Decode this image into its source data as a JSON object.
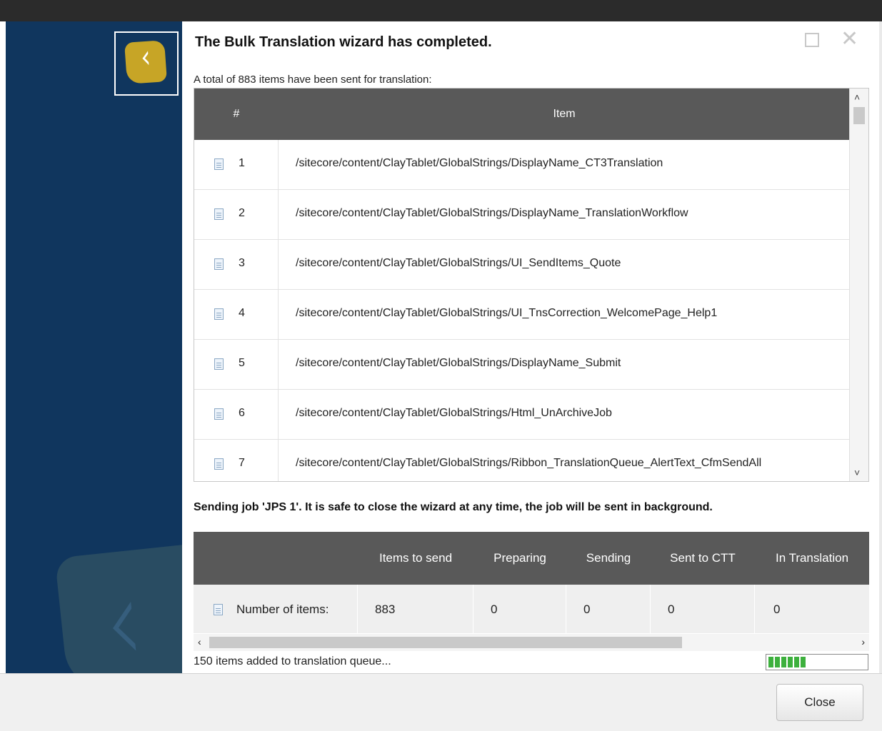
{
  "dialog": {
    "title": "The Bulk Translation wizard has completed.",
    "subtitle": "A total of 883 items have been sent for translation:",
    "maximize_icon": "maximize-icon",
    "close_icon": "close-icon"
  },
  "items_table": {
    "columns": [
      "#",
      "Item"
    ],
    "rows": [
      {
        "num": "1",
        "path": "/sitecore/content/ClayTablet/GlobalStrings/DisplayName_CT3Translation"
      },
      {
        "num": "2",
        "path": "/sitecore/content/ClayTablet/GlobalStrings/DisplayName_TranslationWorkflow"
      },
      {
        "num": "3",
        "path": "/sitecore/content/ClayTablet/GlobalStrings/UI_SendItems_Quote"
      },
      {
        "num": "4",
        "path": "/sitecore/content/ClayTablet/GlobalStrings/UI_TnsCorrection_WelcomePage_Help1"
      },
      {
        "num": "5",
        "path": "/sitecore/content/ClayTablet/GlobalStrings/DisplayName_Submit"
      },
      {
        "num": "6",
        "path": "/sitecore/content/ClayTablet/GlobalStrings/Html_UnArchiveJob"
      },
      {
        "num": "7",
        "path": "/sitecore/content/ClayTablet/GlobalStrings/Ribbon_TranslationQueue_AlertText_CfmSendAll"
      }
    ]
  },
  "status_message": "Sending job 'JPS 1'. It is safe to close the wizard at any time, the job will be sent in background.",
  "status_table": {
    "columns": [
      "",
      "Items to send",
      "Preparing",
      "Sending",
      "Sent to CTT",
      "In Translation"
    ],
    "row": {
      "label": "Number of items:",
      "values": [
        "883",
        "0",
        "0",
        "0",
        "0"
      ]
    }
  },
  "progress": {
    "text": "150 items added to translation queue...",
    "fraction": 0.4,
    "color": "#3db03d"
  },
  "footer": {
    "close_label": "Close"
  },
  "colors": {
    "sidebar": "#10365e",
    "header": "#595959",
    "logo": "#c7a526"
  }
}
